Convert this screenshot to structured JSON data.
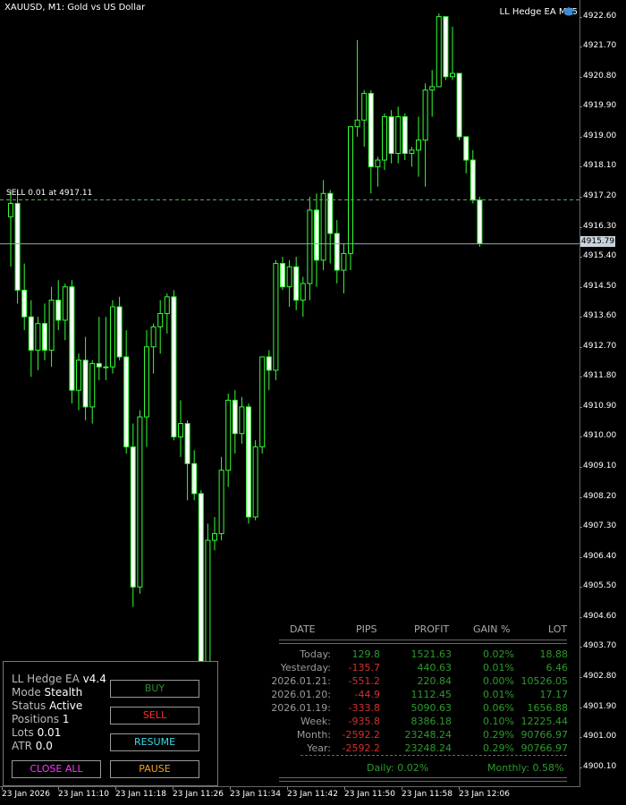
{
  "window": {
    "title": "XAUUSD, M1:  Gold vs US Dollar",
    "ea_badge": "LL Hedge EA MT5"
  },
  "chart_data": {
    "type": "candlestick",
    "symbol": "XAUUSD",
    "timeframe": "M1",
    "ylim": [
      4899.5,
      4923.1
    ],
    "price_ticks": [
      "4922.60",
      "4921.70",
      "4920.80",
      "4919.90",
      "4919.00",
      "4918.10",
      "4917.20",
      "4916.30",
      "4915.40",
      "4914.50",
      "4913.60",
      "4912.70",
      "4911.80",
      "4910.90",
      "4910.00",
      "4909.10",
      "4908.20",
      "4907.30",
      "4906.40",
      "4905.50",
      "4904.60",
      "4903.70",
      "4902.80",
      "4901.90",
      "4901.00",
      "4900.10"
    ],
    "time_ticks": [
      "23 Jan 2026",
      "23 Jan 11:10",
      "23 Jan 11:18",
      "23 Jan 11:26",
      "23 Jan 11:34",
      "23 Jan 11:42",
      "23 Jan 11:50",
      "23 Jan 11:58",
      "23 Jan 12:06"
    ],
    "bid_price": "4915.79",
    "order_line": {
      "label": "SELL 0.01 at 4917.11",
      "price": 4917.11
    },
    "candles": [
      [
        4916.6,
        4917.4,
        4915.1,
        4917.0
      ],
      [
        4917.0,
        4917.4,
        4914.0,
        4914.4
      ],
      [
        4914.4,
        4915.2,
        4913.2,
        4913.6
      ],
      [
        4913.6,
        4914.1,
        4911.8,
        4912.6
      ],
      [
        4912.6,
        4913.6,
        4912.0,
        4913.4
      ],
      [
        4913.4,
        4914.0,
        4912.3,
        4912.6
      ],
      [
        4912.6,
        4914.5,
        4912.1,
        4914.1
      ],
      [
        4914.1,
        4914.7,
        4913.2,
        4913.5
      ],
      [
        4913.5,
        4914.6,
        4912.9,
        4914.5
      ],
      [
        4914.5,
        4914.7,
        4911.0,
        4911.4
      ],
      [
        4911.4,
        4912.5,
        4910.8,
        4912.3
      ],
      [
        4912.3,
        4913.0,
        4910.5,
        4910.9
      ],
      [
        4910.9,
        4912.3,
        4910.4,
        4912.2
      ],
      [
        4912.2,
        4913.6,
        4911.7,
        4912.1
      ],
      [
        4912.1,
        4913.6,
        4911.7,
        4912.1
      ],
      [
        4912.1,
        4914.1,
        4911.9,
        4913.9
      ],
      [
        4913.9,
        4914.2,
        4912.3,
        4912.4
      ],
      [
        4912.4,
        4913.2,
        4909.5,
        4909.7
      ],
      [
        4909.7,
        4910.4,
        4904.9,
        4905.5
      ],
      [
        4905.5,
        4910.8,
        4905.3,
        4910.6
      ],
      [
        4910.6,
        4913.2,
        4909.7,
        4912.7
      ],
      [
        4912.7,
        4913.4,
        4911.9,
        4913.3
      ],
      [
        4913.3,
        4914.1,
        4912.5,
        4913.7
      ],
      [
        4913.7,
        4914.3,
        4913.1,
        4914.2
      ],
      [
        4914.2,
        4914.4,
        4909.9,
        4910.0
      ],
      [
        4910.0,
        4911.1,
        4909.4,
        4910.4
      ],
      [
        4910.4,
        4910.5,
        4908.1,
        4909.2
      ],
      [
        4909.2,
        4909.6,
        4908.1,
        4908.3
      ],
      [
        4908.3,
        4908.4,
        4902.8,
        4903.0
      ],
      [
        4903.0,
        4907.4,
        4902.6,
        4906.9
      ],
      [
        4906.9,
        4907.6,
        4906.6,
        4907.1
      ],
      [
        4907.1,
        4909.4,
        4906.9,
        4909.0
      ],
      [
        4909.0,
        4911.3,
        4908.5,
        4911.1
      ],
      [
        4911.1,
        4911.4,
        4909.5,
        4910.1
      ],
      [
        4910.1,
        4911.2,
        4909.8,
        4910.9
      ],
      [
        4910.9,
        4911.0,
        4907.4,
        4907.6
      ],
      [
        4907.6,
        4909.9,
        4907.5,
        4909.7
      ],
      [
        4909.7,
        4912.4,
        4909.5,
        4912.4
      ],
      [
        4912.4,
        4912.6,
        4911.4,
        4912.0
      ],
      [
        4912.0,
        4915.3,
        4911.7,
        4915.2
      ],
      [
        4915.2,
        4915.4,
        4914.4,
        4914.5
      ],
      [
        4914.5,
        4915.3,
        4913.9,
        4915.1
      ],
      [
        4915.1,
        4915.4,
        4913.8,
        4914.1
      ],
      [
        4914.1,
        4914.8,
        4913.6,
        4914.6
      ],
      [
        4914.6,
        4917.2,
        4914.1,
        4916.8
      ],
      [
        4916.8,
        4917.3,
        4914.5,
        4915.3
      ],
      [
        4915.3,
        4917.7,
        4915.0,
        4917.3
      ],
      [
        4917.3,
        4917.4,
        4915.2,
        4916.1
      ],
      [
        4916.1,
        4916.5,
        4914.6,
        4915.0
      ],
      [
        4915.0,
        4915.8,
        4914.3,
        4915.5
      ],
      [
        4915.5,
        4919.3,
        4915.0,
        4919.3
      ],
      [
        4919.3,
        4921.9,
        4919.0,
        4919.5
      ],
      [
        4919.5,
        4920.4,
        4918.7,
        4920.3
      ],
      [
        4920.3,
        4920.4,
        4917.3,
        4918.1
      ],
      [
        4918.1,
        4918.4,
        4917.5,
        4918.3
      ],
      [
        4918.3,
        4919.7,
        4918.0,
        4919.6
      ],
      [
        4919.6,
        4919.8,
        4918.2,
        4918.5
      ],
      [
        4918.5,
        4919.9,
        4918.2,
        4919.6
      ],
      [
        4919.6,
        4919.7,
        4918.3,
        4918.5
      ],
      [
        4918.5,
        4918.7,
        4918.1,
        4918.6
      ],
      [
        4918.6,
        4919.6,
        4917.8,
        4918.9
      ],
      [
        4918.9,
        4920.6,
        4917.5,
        4920.4
      ],
      [
        4920.4,
        4921.0,
        4919.6,
        4920.5
      ],
      [
        4920.5,
        4922.7,
        4920.5,
        4922.6
      ],
      [
        4922.6,
        4922.6,
        4920.7,
        4920.8
      ],
      [
        4920.8,
        4922.3,
        4920.7,
        4920.9
      ],
      [
        4920.9,
        4920.9,
        4918.9,
        4919.0
      ],
      [
        4919.0,
        4919.0,
        4917.9,
        4918.3
      ],
      [
        4918.3,
        4918.6,
        4917.0,
        4917.1
      ],
      [
        4917.1,
        4917.2,
        4915.7,
        4915.8
      ]
    ]
  },
  "panel": {
    "title_label": "LL Hedge EA",
    "version": "v4.4",
    "mode_label": "Mode",
    "mode_value": "Stealth",
    "status_label": "Status",
    "status_value": "Active",
    "positions_label": "Positions",
    "positions_value": "1",
    "lots_label": "Lots",
    "lots_value": "0.01",
    "atr_label": "ATR",
    "atr_value": "0.0",
    "buttons": {
      "buy": "BUY",
      "sell": "SELL",
      "resume": "RESUME",
      "close_all": "CLOSE ALL",
      "pause": "PAUSE"
    },
    "colors": {
      "buy": "#2e8b2e",
      "sell": "#ff2a2a",
      "resume": "#3cd7e6",
      "close_all": "#ff33ff",
      "pause": "#f0a020"
    }
  },
  "stats": {
    "headers": [
      "DATE",
      "PIPS",
      "PROFIT",
      "GAIN %",
      "LOT"
    ],
    "separator": "=======================================",
    "rows": [
      {
        "date": "Today:",
        "pips": "129.8",
        "profit": "1521.63",
        "gain": "0.02%",
        "lot": "18.88",
        "neg": false
      },
      {
        "date": "Yesterday:",
        "pips": "-135.7",
        "profit": "440.63",
        "gain": "0.01%",
        "lot": "6.46",
        "neg": true
      },
      {
        "date": "2026.01.21:",
        "pips": "-551.2",
        "profit": "220.84",
        "gain": "0.00%",
        "lot": "10526.05",
        "neg": true
      },
      {
        "date": "2026.01.20:",
        "pips": "-44.9",
        "profit": "1112.45",
        "gain": "0.01%",
        "lot": "17.17",
        "neg": true
      },
      {
        "date": "2026.01.19:",
        "pips": "-333.8",
        "profit": "5090.63",
        "gain": "0.06%",
        "lot": "1656.88",
        "neg": true
      },
      {
        "date": "Week:",
        "pips": "-935.8",
        "profit": "8386.18",
        "gain": "0.10%",
        "lot": "12225.44",
        "neg": true
      },
      {
        "date": "Month:",
        "pips": "-2592.2",
        "profit": "23248.24",
        "gain": "0.29%",
        "lot": "90766.97",
        "neg": true
      },
      {
        "date": "Year:",
        "pips": "-2592.2",
        "profit": "23248.24",
        "gain": "0.29%",
        "lot": "90766.97",
        "neg": true
      }
    ],
    "daily": "Daily: 0.02%",
    "monthly": "Monthly: 0.58%",
    "colors": {
      "label": "#9a9a9a",
      "positive": "#2e9a2e",
      "negative": "#d23030",
      "neutral": "#9a9a9a"
    }
  }
}
